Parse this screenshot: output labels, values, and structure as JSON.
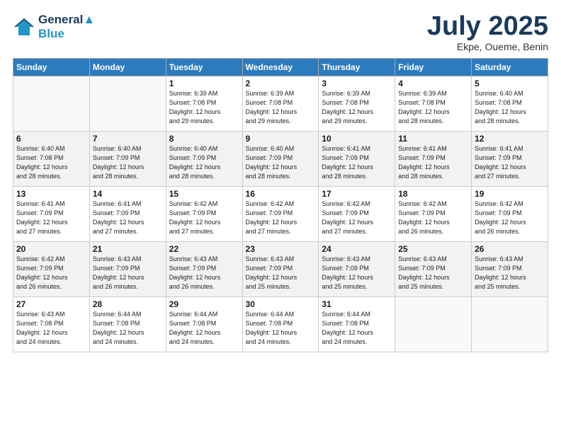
{
  "header": {
    "logo_line1": "General",
    "logo_line2": "Blue",
    "month": "July 2025",
    "location": "Ekpe, Oueme, Benin"
  },
  "weekdays": [
    "Sunday",
    "Monday",
    "Tuesday",
    "Wednesday",
    "Thursday",
    "Friday",
    "Saturday"
  ],
  "weeks": [
    [
      {
        "day": "",
        "info": ""
      },
      {
        "day": "",
        "info": ""
      },
      {
        "day": "1",
        "info": "Sunrise: 6:39 AM\nSunset: 7:08 PM\nDaylight: 12 hours\nand 29 minutes."
      },
      {
        "day": "2",
        "info": "Sunrise: 6:39 AM\nSunset: 7:08 PM\nDaylight: 12 hours\nand 29 minutes."
      },
      {
        "day": "3",
        "info": "Sunrise: 6:39 AM\nSunset: 7:08 PM\nDaylight: 12 hours\nand 29 minutes."
      },
      {
        "day": "4",
        "info": "Sunrise: 6:39 AM\nSunset: 7:08 PM\nDaylight: 12 hours\nand 28 minutes."
      },
      {
        "day": "5",
        "info": "Sunrise: 6:40 AM\nSunset: 7:08 PM\nDaylight: 12 hours\nand 28 minutes."
      }
    ],
    [
      {
        "day": "6",
        "info": "Sunrise: 6:40 AM\nSunset: 7:08 PM\nDaylight: 12 hours\nand 28 minutes."
      },
      {
        "day": "7",
        "info": "Sunrise: 6:40 AM\nSunset: 7:09 PM\nDaylight: 12 hours\nand 28 minutes."
      },
      {
        "day": "8",
        "info": "Sunrise: 6:40 AM\nSunset: 7:09 PM\nDaylight: 12 hours\nand 28 minutes."
      },
      {
        "day": "9",
        "info": "Sunrise: 6:40 AM\nSunset: 7:09 PM\nDaylight: 12 hours\nand 28 minutes."
      },
      {
        "day": "10",
        "info": "Sunrise: 6:41 AM\nSunset: 7:09 PM\nDaylight: 12 hours\nand 28 minutes."
      },
      {
        "day": "11",
        "info": "Sunrise: 6:41 AM\nSunset: 7:09 PM\nDaylight: 12 hours\nand 28 minutes."
      },
      {
        "day": "12",
        "info": "Sunrise: 6:41 AM\nSunset: 7:09 PM\nDaylight: 12 hours\nand 27 minutes."
      }
    ],
    [
      {
        "day": "13",
        "info": "Sunrise: 6:41 AM\nSunset: 7:09 PM\nDaylight: 12 hours\nand 27 minutes."
      },
      {
        "day": "14",
        "info": "Sunrise: 6:41 AM\nSunset: 7:09 PM\nDaylight: 12 hours\nand 27 minutes."
      },
      {
        "day": "15",
        "info": "Sunrise: 6:42 AM\nSunset: 7:09 PM\nDaylight: 12 hours\nand 27 minutes."
      },
      {
        "day": "16",
        "info": "Sunrise: 6:42 AM\nSunset: 7:09 PM\nDaylight: 12 hours\nand 27 minutes."
      },
      {
        "day": "17",
        "info": "Sunrise: 6:42 AM\nSunset: 7:09 PM\nDaylight: 12 hours\nand 27 minutes."
      },
      {
        "day": "18",
        "info": "Sunrise: 6:42 AM\nSunset: 7:09 PM\nDaylight: 12 hours\nand 26 minutes."
      },
      {
        "day": "19",
        "info": "Sunrise: 6:42 AM\nSunset: 7:09 PM\nDaylight: 12 hours\nand 26 minutes."
      }
    ],
    [
      {
        "day": "20",
        "info": "Sunrise: 6:42 AM\nSunset: 7:09 PM\nDaylight: 12 hours\nand 26 minutes."
      },
      {
        "day": "21",
        "info": "Sunrise: 6:43 AM\nSunset: 7:09 PM\nDaylight: 12 hours\nand 26 minutes."
      },
      {
        "day": "22",
        "info": "Sunrise: 6:43 AM\nSunset: 7:09 PM\nDaylight: 12 hours\nand 26 minutes."
      },
      {
        "day": "23",
        "info": "Sunrise: 6:43 AM\nSunset: 7:09 PM\nDaylight: 12 hours\nand 25 minutes."
      },
      {
        "day": "24",
        "info": "Sunrise: 6:43 AM\nSunset: 7:09 PM\nDaylight: 12 hours\nand 25 minutes."
      },
      {
        "day": "25",
        "info": "Sunrise: 6:43 AM\nSunset: 7:09 PM\nDaylight: 12 hours\nand 25 minutes."
      },
      {
        "day": "26",
        "info": "Sunrise: 6:43 AM\nSunset: 7:09 PM\nDaylight: 12 hours\nand 25 minutes."
      }
    ],
    [
      {
        "day": "27",
        "info": "Sunrise: 6:43 AM\nSunset: 7:08 PM\nDaylight: 12 hours\nand 24 minutes."
      },
      {
        "day": "28",
        "info": "Sunrise: 6:44 AM\nSunset: 7:08 PM\nDaylight: 12 hours\nand 24 minutes."
      },
      {
        "day": "29",
        "info": "Sunrise: 6:44 AM\nSunset: 7:08 PM\nDaylight: 12 hours\nand 24 minutes."
      },
      {
        "day": "30",
        "info": "Sunrise: 6:44 AM\nSunset: 7:08 PM\nDaylight: 12 hours\nand 24 minutes."
      },
      {
        "day": "31",
        "info": "Sunrise: 6:44 AM\nSunset: 7:08 PM\nDaylight: 12 hours\nand 24 minutes."
      },
      {
        "day": "",
        "info": ""
      },
      {
        "day": "",
        "info": ""
      }
    ]
  ]
}
